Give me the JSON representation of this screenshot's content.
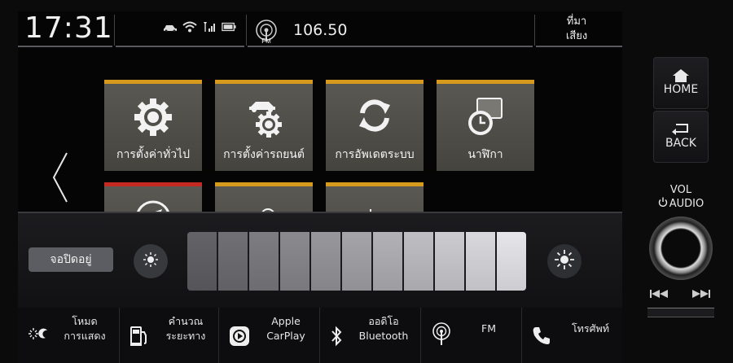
{
  "status_bar": {
    "time": "17:31",
    "icons": [
      "car-connect-icon",
      "wifi-icon",
      "signal-icon",
      "battery-icon"
    ],
    "radio_icon": "radio-fm-icon",
    "radio_band": "FM",
    "frequency": "106.50",
    "source_button": {
      "line1": "ที่มา",
      "line2": "เสียง"
    }
  },
  "tiles": [
    {
      "label": "การตั้งค่าทั่วไป",
      "icon": "gear-icon"
    },
    {
      "label": "การตั้งค่ารถยนต์",
      "icon": "car-settings-icon"
    },
    {
      "label": "การอัพเดตระบบ",
      "icon": "refresh-icon"
    },
    {
      "label": "นาฬิกา",
      "icon": "clock-icon"
    }
  ],
  "brightness": {
    "screen_off_label": "จอปิดอยู่",
    "segments": 11,
    "level": 1.0
  },
  "bottom_bar": [
    {
      "line1": "โหมด",
      "line2": "การแสดง",
      "icon": "display-mode-icon"
    },
    {
      "line1": "คำนวณ",
      "line2": "ระยะทาง",
      "icon": "fuel-range-icon"
    },
    {
      "line1": "Apple",
      "line2": "CarPlay",
      "icon": "carplay-icon"
    },
    {
      "line1": "ออดิโอ",
      "line2": "Bluetooth",
      "icon": "bluetooth-icon"
    },
    {
      "line1": "FM",
      "line2": "",
      "icon": "radio-icon"
    },
    {
      "line1": "โทรศัพท์",
      "line2": "",
      "icon": "phone-icon"
    }
  ],
  "hardware": {
    "home": "HOME",
    "back": "BACK",
    "vol_line1": "VOL",
    "vol_line2": "AUDIO"
  },
  "colors": {
    "tile_accent": "#d69a1c",
    "tile_accent_red": "#c42a22"
  }
}
